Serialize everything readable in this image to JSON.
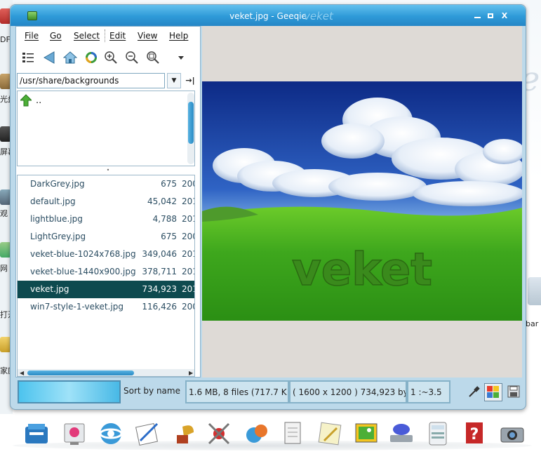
{
  "window": {
    "title": "veket.jpg - Geeqie",
    "title_deco": "veket",
    "controls": {
      "minimize": "_",
      "maximize": "□",
      "close": "X"
    }
  },
  "menu": {
    "file": "File",
    "go": "Go",
    "select": "Select",
    "edit": "Edit",
    "view": "View",
    "help": "Help"
  },
  "toolbar": {
    "icons": [
      "thumbnails-icon",
      "back-icon",
      "home-icon",
      "refresh-icon",
      "zoom-in-icon",
      "zoom-out-icon",
      "zoom-fit-icon",
      "more-icon"
    ]
  },
  "path": {
    "value": "/usr/share/backgrounds"
  },
  "dirlist": {
    "items": [
      {
        "label": ".."
      }
    ]
  },
  "files": {
    "rows": [
      {
        "name": "DarkGrey.jpg",
        "size": "675",
        "date": "200"
      },
      {
        "name": "default.jpg",
        "size": "45,042",
        "date": "201"
      },
      {
        "name": "lightblue.jpg",
        "size": "4,788",
        "date": "201"
      },
      {
        "name": "LightGrey.jpg",
        "size": "675",
        "date": "200"
      },
      {
        "name": "veket-blue-1024x768.jpg",
        "size": "349,046",
        "date": "201"
      },
      {
        "name": "veket-blue-1440x900.jpg",
        "size": "378,711",
        "date": "201"
      },
      {
        "name": "veket.jpg",
        "size": "734,923",
        "date": "201",
        "selected": true
      },
      {
        "name": "win7-style-1-veket.jpg",
        "size": "116,426",
        "date": "200"
      }
    ]
  },
  "image": {
    "watermark": "veket"
  },
  "status": {
    "sort": "Sort by name",
    "files": "1.6 MB, 8 files (717.7 K",
    "dims": "( 1600 x 1200 ) 734,923 by",
    "zoom": "1 :~3.5"
  },
  "desktop": {
    "left_labels": [
      "DF",
      "光盘",
      "屏幕",
      "观",
      "网",
      "打开",
      "家庭"
    ],
    "right_label": "bar"
  },
  "colors": {
    "titlebar": "#2e9ad8",
    "selected_row": "#0e4a4f",
    "sky_top": "#0f2f8a",
    "grass": "#3fae1c"
  }
}
